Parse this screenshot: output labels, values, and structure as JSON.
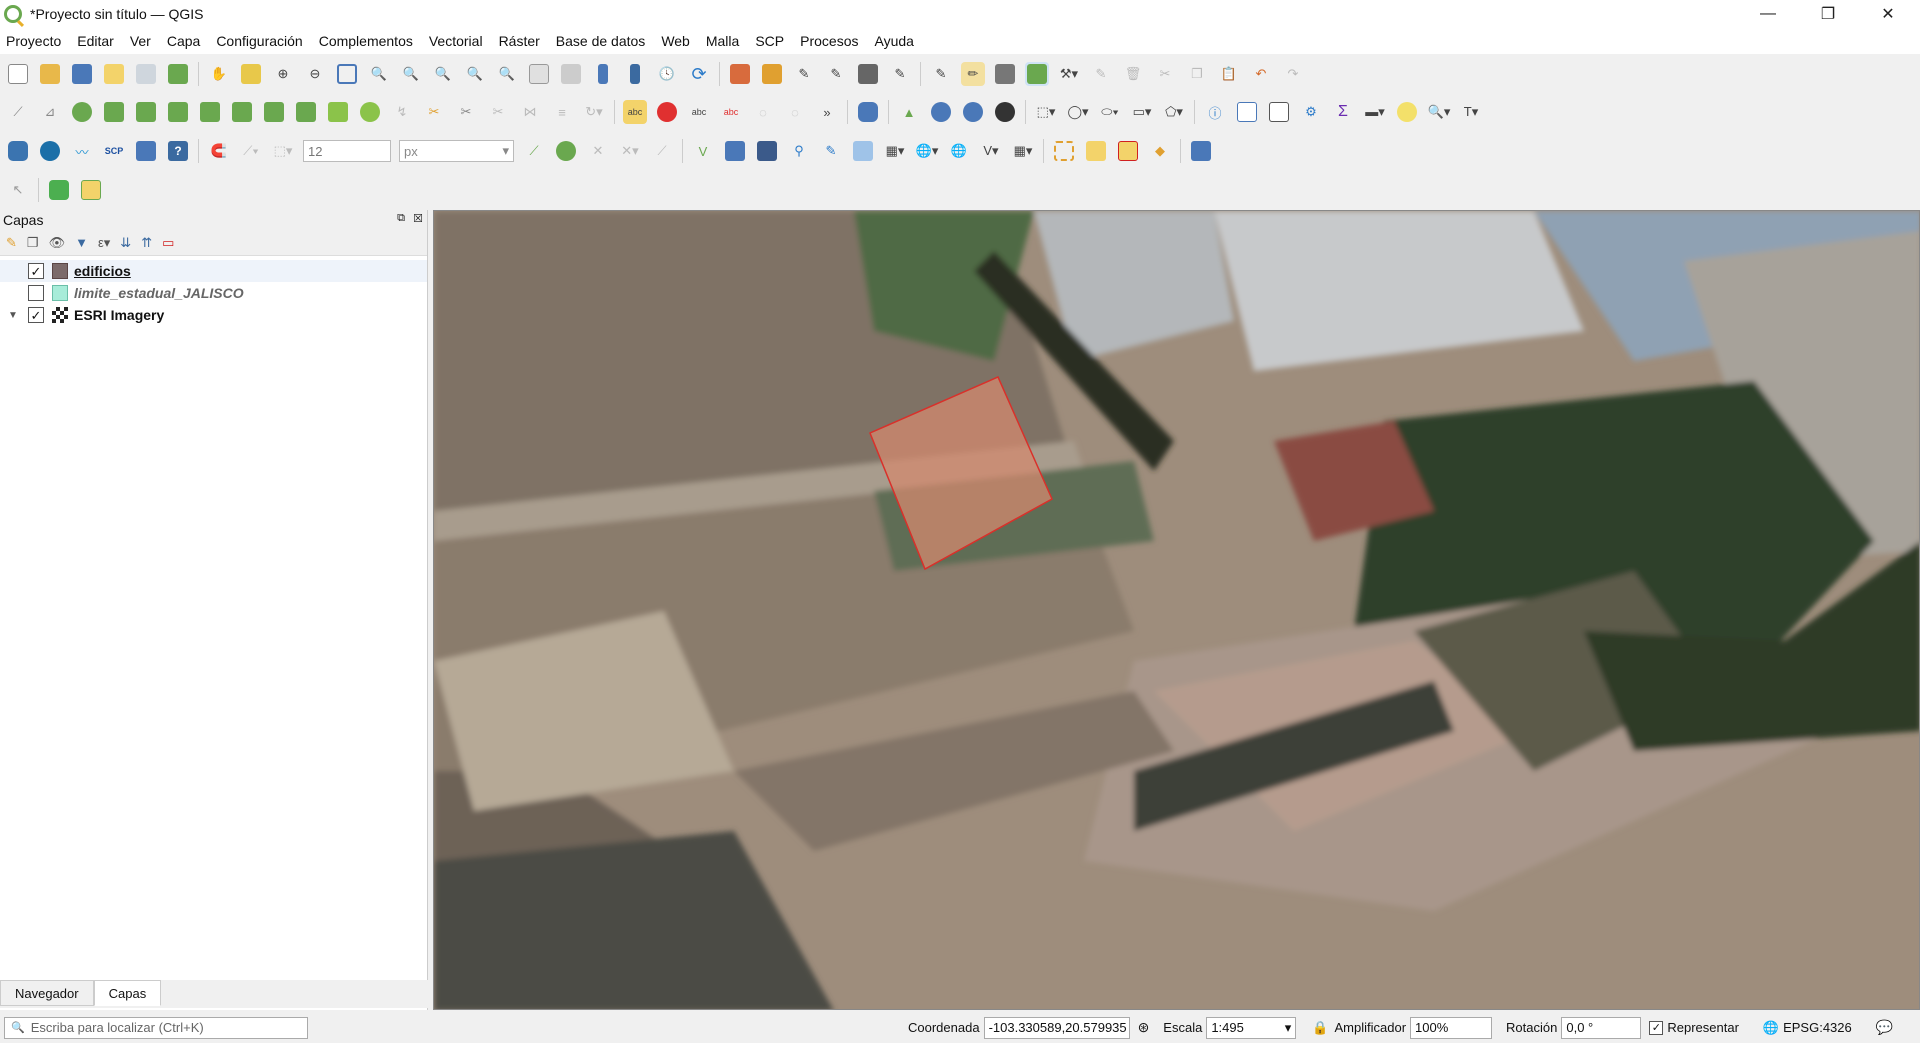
{
  "window": {
    "title": "*Proyecto sin título — QGIS",
    "controls": [
      "—",
      "❐",
      "✕"
    ]
  },
  "menubar": [
    "Proyecto",
    "Editar",
    "Ver",
    "Capa",
    "Configuración",
    "Complementos",
    "Vectorial",
    "Ráster",
    "Base de datos",
    "Web",
    "Malla",
    "SCP",
    "Procesos",
    "Ayuda"
  ],
  "toolbar": {
    "snapping_tolerance": "12",
    "snapping_units": "px"
  },
  "layers_panel": {
    "title": "Capas",
    "layers": [
      {
        "name": "edificios",
        "checked": true,
        "bold": true,
        "italic": false,
        "expandable": false
      },
      {
        "name": "limite_estadual_JALISCO",
        "checked": false,
        "bold": true,
        "italic": true,
        "expandable": false
      },
      {
        "name": "ESRI Imagery",
        "checked": true,
        "bold": true,
        "italic": false,
        "expandable": true
      }
    ],
    "tabs": [
      "Navegador",
      "Capas"
    ],
    "active_tab": "Capas"
  },
  "statusbar": {
    "locator_placeholder": "Escriba para localizar (Ctrl+K)",
    "coord_label": "Coordenada",
    "coord_value": "-103.330589,20.579935",
    "scale_label": "Escala",
    "scale_value": "1:495",
    "magnifier_label": "Amplificador",
    "magnifier_value": "100%",
    "rotation_label": "Rotación",
    "rotation_value": "0,0 °",
    "render_label": "Representar",
    "crs": "EPSG:4326"
  },
  "colors": {
    "polygon_fill": "#d38a6f",
    "polygon_stroke": "#d9302a",
    "limite_symbol": "#a8ecd9",
    "map_ground": "#9e8d7c"
  }
}
